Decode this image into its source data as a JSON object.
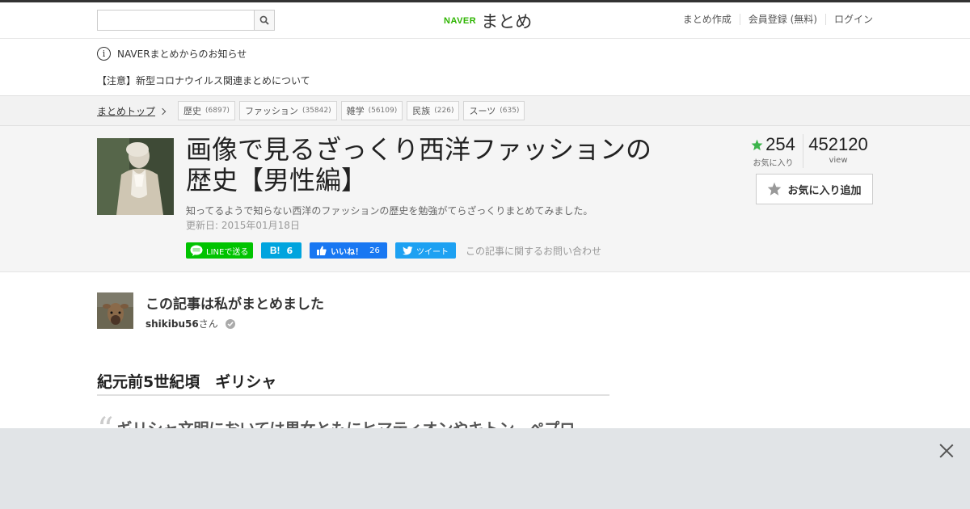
{
  "header": {
    "search_placeholder": "",
    "logo_brand": "NAVER",
    "logo_name": "まとめ",
    "links": [
      "まとめ作成",
      "会員登録 (無料)",
      "ログイン"
    ]
  },
  "notice": {
    "title": "NAVERまとめからのお知らせ",
    "link": "【注意】新型コロナウイルス関連まとめについて"
  },
  "breadcrumb": {
    "top": "まとめトップ",
    "tags": [
      {
        "label": "歴史",
        "count": "(6897)"
      },
      {
        "label": "ファッション",
        "count": "(35842)"
      },
      {
        "label": "雑学",
        "count": "(56109)"
      },
      {
        "label": "民族",
        "count": "(226)"
      },
      {
        "label": "スーツ",
        "count": "(635)"
      }
    ]
  },
  "article": {
    "title_line1": "画像で見るざっくり西洋ファッションの",
    "title_line2": "歴史【男性編】",
    "description": "知ってるようで知らない西洋のファッションの歴史を勉強がてらざっくりまとめてみました。",
    "updated": "更新日: 2015年01月18日",
    "favorites": "254",
    "favorites_label": "お気に入り",
    "views": "452120",
    "views_label": "view",
    "fav_button": "お気に入り追加"
  },
  "social": {
    "line": "LINEで送る",
    "hatena_icon": "B!",
    "hatena_count": "6",
    "fb_label": "いいね！",
    "fb_count": "26",
    "tweet": "ツイート",
    "contact": "この記事に関するお問い合わせ"
  },
  "author": {
    "heading": "この記事は私がまとめました",
    "name": "shikibu56",
    "suffix": "さん"
  },
  "content": {
    "section_title": "紀元前5世紀頃　ギリシャ",
    "quote": "ギリシャ文明においては男女ともにヒマティオンやキトン、ペプロ"
  },
  "colors": {
    "naver_green": "#2db400",
    "line_green": "#00c300",
    "hatena_blue": "#00a4de",
    "facebook_blue": "#1877f2",
    "twitter_blue": "#1da1f2",
    "star_green": "#3cb44b"
  }
}
